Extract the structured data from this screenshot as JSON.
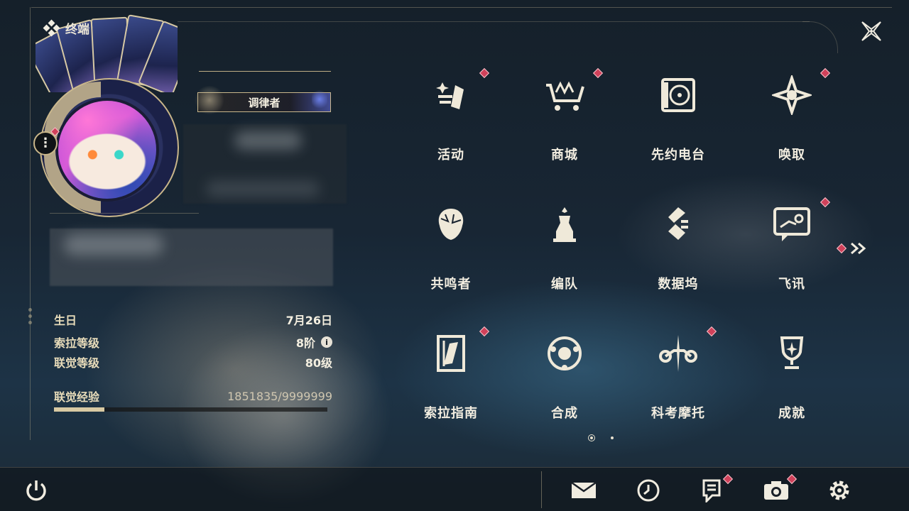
{
  "title": "终端",
  "profile": {
    "rank": "调律者",
    "stats": [
      {
        "label": "生日",
        "value": "7月26日"
      },
      {
        "label": "索拉等级",
        "value": "8阶",
        "info": true
      },
      {
        "label": "联觉等级",
        "value": "80级"
      }
    ],
    "exp": {
      "label": "联觉经验",
      "value": "1851835/9999999",
      "progress": 0.185
    }
  },
  "menu": [
    {
      "label": "活动",
      "icon": "activity-icon",
      "badge": true
    },
    {
      "label": "商城",
      "icon": "shop-cart-icon",
      "badge": true
    },
    {
      "label": "先约电台",
      "icon": "radio-icon",
      "badge": false
    },
    {
      "label": "唤取",
      "icon": "compass-star-icon",
      "badge": true
    },
    {
      "label": "共鸣者",
      "icon": "resonator-head-icon",
      "badge": false
    },
    {
      "label": "编队",
      "icon": "chess-team-icon",
      "badge": false
    },
    {
      "label": "数据坞",
      "icon": "databank-icon",
      "badge": false
    },
    {
      "label": "飞讯",
      "icon": "message-icon",
      "badge": true
    },
    {
      "label": "索拉指南",
      "icon": "guide-icon",
      "badge": true
    },
    {
      "label": "合成",
      "icon": "synthesis-icon",
      "badge": false
    },
    {
      "label": "科考摩托",
      "icon": "motorcycle-icon",
      "badge": true
    },
    {
      "label": "成就",
      "icon": "trophy-icon",
      "badge": false
    }
  ],
  "pagination": {
    "pages": 2,
    "current": 1
  },
  "bottom_bar": {
    "left": [
      "power-icon"
    ],
    "right": [
      {
        "icon": "mail-icon",
        "badge": false
      },
      {
        "icon": "clock-icon",
        "badge": false
      },
      {
        "icon": "notice-icon",
        "badge": true
      },
      {
        "icon": "camera-icon",
        "badge": true
      },
      {
        "icon": "settings-gear-icon",
        "badge": false
      }
    ]
  },
  "colors": {
    "accent_gold": "#c9b68a",
    "badge_red": "#d0415a",
    "text": "#f2ede0"
  }
}
